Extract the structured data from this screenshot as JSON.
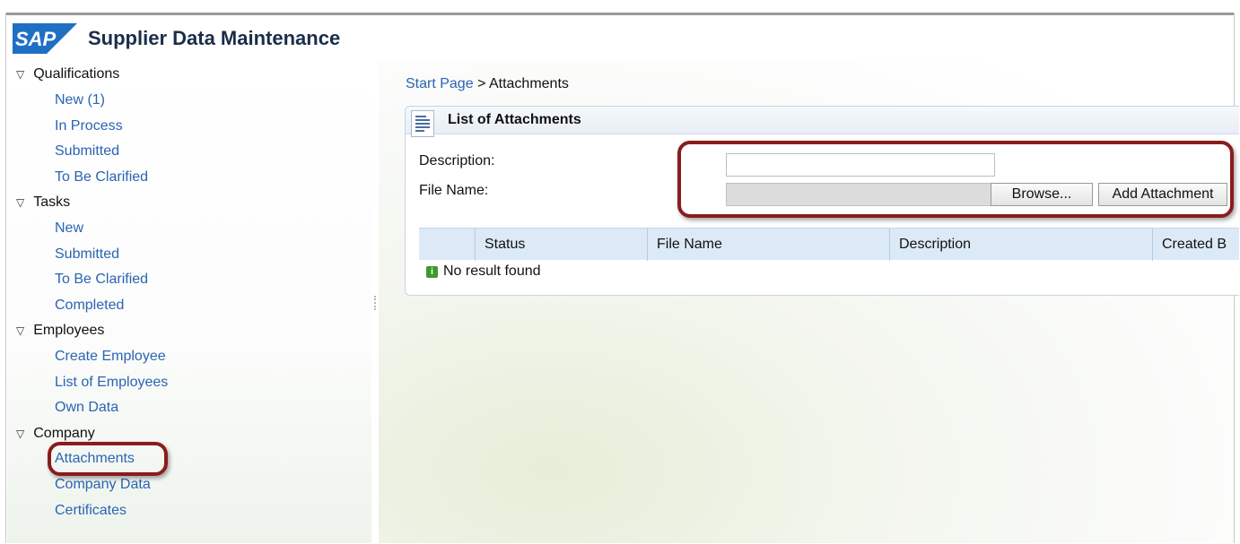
{
  "app": {
    "title": "Supplier Data Maintenance",
    "logo_text": "SAP"
  },
  "sidebar": {
    "groups": [
      {
        "label": "Qualifications",
        "items": [
          "New (1)",
          "In Process",
          "Submitted",
          "To Be Clarified"
        ]
      },
      {
        "label": "Tasks",
        "items": [
          "New",
          "Submitted",
          "To Be Clarified",
          "Completed"
        ]
      },
      {
        "label": "Employees",
        "items": [
          "Create Employee",
          "List of Employees",
          "Own Data"
        ]
      },
      {
        "label": "Company",
        "items": [
          "Attachments",
          "Company Data",
          "Certificates"
        ]
      }
    ],
    "expand_glyph": "▽",
    "selected_item": "Attachments"
  },
  "breadcrumb": {
    "link": "Start Page",
    "separator": ">",
    "current": "Attachments"
  },
  "panel": {
    "title": "List of Attachments",
    "icon": "document-list-icon",
    "description_label": "Description:",
    "description_value": "",
    "filename_label": "File Name:",
    "filename_value": "",
    "browse_label": "Browse...",
    "add_label": "Add Attachment"
  },
  "table": {
    "columns": [
      "Status",
      "File Name",
      "Description",
      "Created B"
    ],
    "empty_message": "No result found",
    "empty_icon": "info-icon",
    "empty_icon_glyph": "i"
  },
  "colors": {
    "link": "#2a64b3",
    "highlight": "#8a1c1c",
    "table_header": "#dceaf8",
    "logo_blue": "#1f6fc4"
  }
}
